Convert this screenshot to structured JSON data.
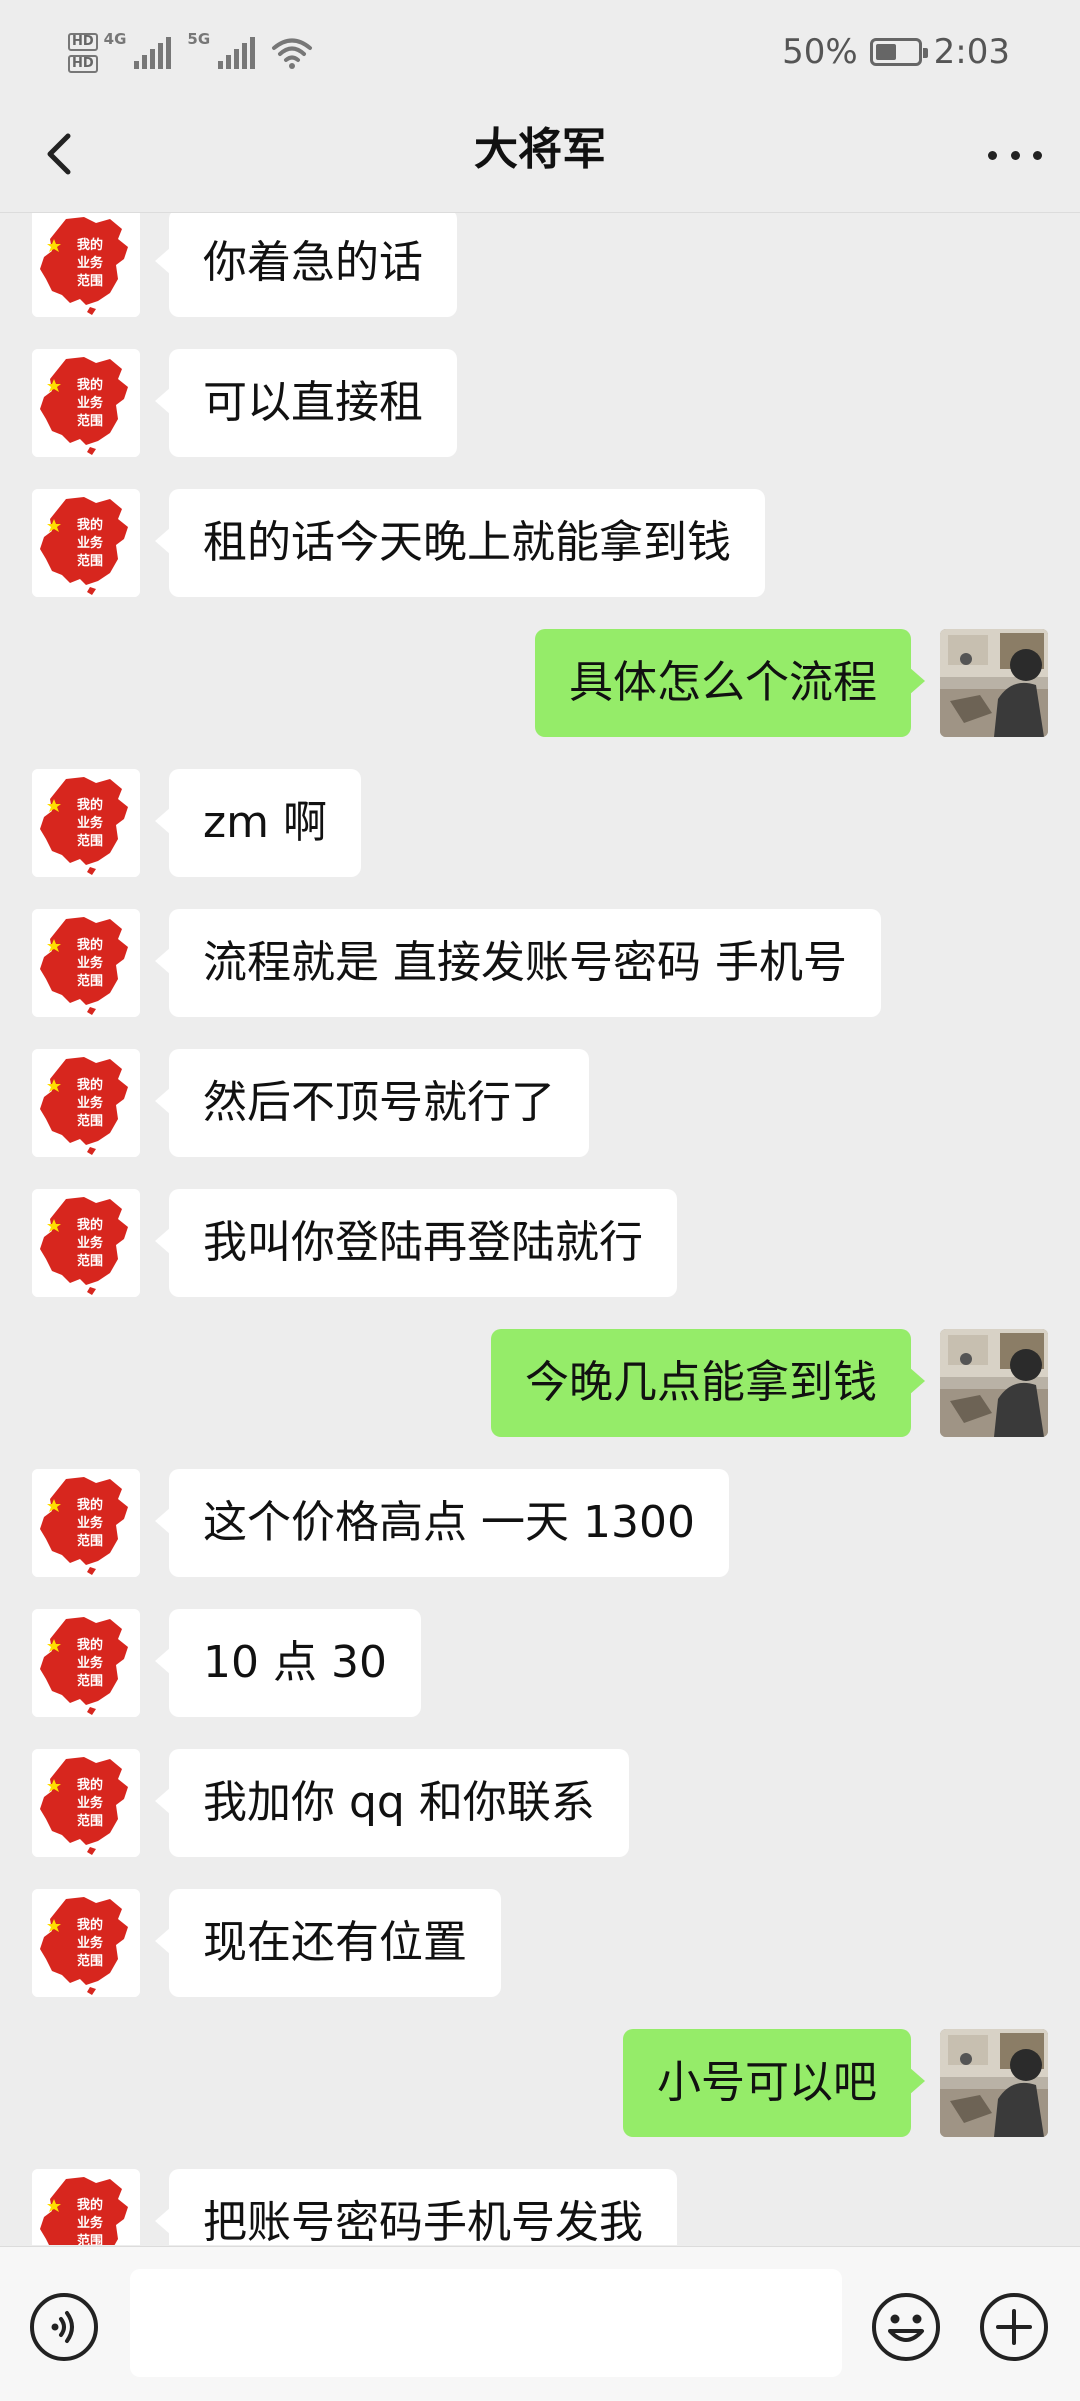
{
  "status_bar": {
    "network_left": "4G",
    "network_right": "5G",
    "battery": "50%",
    "battery_level": 0.5,
    "time": "2:03",
    "hd_labels": [
      "HD",
      "HD"
    ]
  },
  "header": {
    "title": "大将军",
    "back_icon": "chevron-left-icon",
    "more_icon": "more-dots-icon"
  },
  "messages": [
    {
      "side": "in",
      "text": "你着急的话"
    },
    {
      "side": "in",
      "text": "可以直接租"
    },
    {
      "side": "in",
      "text": "租的话今天晚上就能拿到钱"
    },
    {
      "side": "out",
      "text": "具体怎么个流程"
    },
    {
      "side": "in",
      "text": "zm 啊"
    },
    {
      "side": "in",
      "text": "流程就是 直接发账号密码 手机号"
    },
    {
      "side": "in",
      "text": "然后不顶号就行了"
    },
    {
      "side": "in",
      "text": "我叫你登陆再登陆就行"
    },
    {
      "side": "out",
      "text": "今晚几点能拿到钱"
    },
    {
      "side": "in",
      "text": "这个价格高点 一天 1300"
    },
    {
      "side": "in",
      "text": "10 点 30"
    },
    {
      "side": "in",
      "text": "我加你 qq 和你联系"
    },
    {
      "side": "in",
      "text": "现在还有位置"
    },
    {
      "side": "out",
      "text": "小号可以吧"
    },
    {
      "side": "in",
      "text": "把账号密码手机号发我"
    }
  ],
  "avatar_in_text": [
    "我的",
    "业务",
    "范围"
  ],
  "input_bar": {
    "value": "",
    "voice_icon": "voice-icon",
    "emoji_icon": "emoji-icon",
    "plus_icon": "plus-circle-icon"
  },
  "colors": {
    "background": "#ededed",
    "outgoing_bubble": "#95ec69",
    "incoming_bubble": "#ffffff",
    "avatar_map": "#d7261e"
  }
}
